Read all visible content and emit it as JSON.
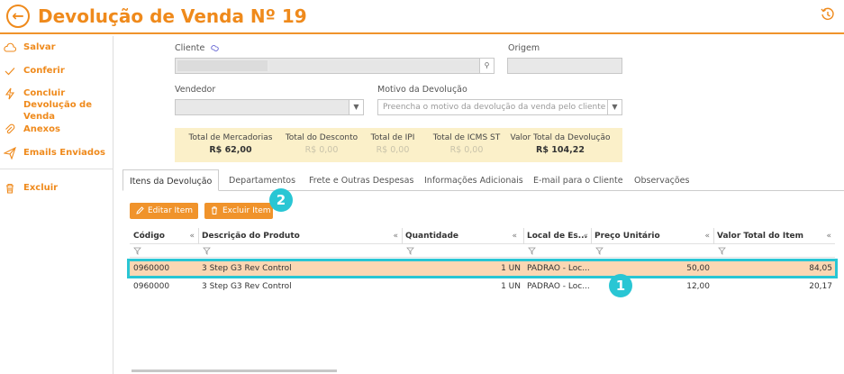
{
  "header": {
    "title": "Devolução de Venda Nº 19",
    "back_icon": "arrow-left-circle-icon",
    "history_icon": "history-icon"
  },
  "sidebar": {
    "items": [
      {
        "label": "Salvar",
        "icon": "cloud-icon"
      },
      {
        "label": "Conferir",
        "icon": "check-icon"
      },
      {
        "label": "Concluir Devolução de Venda",
        "icon": "lightning-icon"
      },
      {
        "label": "Anexos",
        "icon": "paperclip-icon"
      },
      {
        "label": "Emails Enviados",
        "icon": "send-icon"
      },
      {
        "label": "Excluir",
        "icon": "trash-icon"
      }
    ]
  },
  "form": {
    "cliente_label": "Cliente",
    "origem_label": "Origem",
    "vendedor_label": "Vendedor",
    "motivo_label": "Motivo da Devolução",
    "motivo_placeholder": "Preencha o motivo da devolução da venda pelo cliente"
  },
  "totals": [
    {
      "title": "Total de Mercadorias",
      "value": "R$ 62,00"
    },
    {
      "title": "Total do Desconto",
      "value": "R$ 0,00"
    },
    {
      "title": "Total de IPI",
      "value": "R$ 0,00"
    },
    {
      "title": "Total de ICMS ST",
      "value": "R$ 0,00"
    },
    {
      "title": "Valor Total da Devolução",
      "value": "R$ 104,22"
    }
  ],
  "tabs": [
    "Itens da Devolução",
    "Departamentos",
    "Frete e Outras Despesas",
    "Informações Adicionais",
    "E-mail para o Cliente",
    "Observações"
  ],
  "actions": {
    "edit_label": "Editar Item",
    "delete_label": "Excluir Item"
  },
  "grid": {
    "columns": [
      "Código",
      "Descrição do Produto",
      "Quantidade",
      "Local de Es...",
      "Preço Unitário",
      "Valor Total do Item"
    ],
    "rows": [
      {
        "codigo": "0960000",
        "descricao": "3 Step G3 Rev Control",
        "quantidade": "1 UN",
        "local": "PADRAO - Loc...",
        "preco": "50,00",
        "total": "84,05"
      },
      {
        "codigo": "0960000",
        "descricao": "3 Step G3 Rev Control",
        "quantidade": "1 UN",
        "local": "PADRAO - Loc...",
        "preco": "12,00",
        "total": "20,17"
      }
    ]
  },
  "annotations": [
    "1",
    "2"
  ],
  "colors": {
    "accent": "#ef8a1c",
    "highlight": "#29c6d4",
    "selected_row": "#fbd7b3",
    "totals_bg": "#fbf0c9"
  }
}
